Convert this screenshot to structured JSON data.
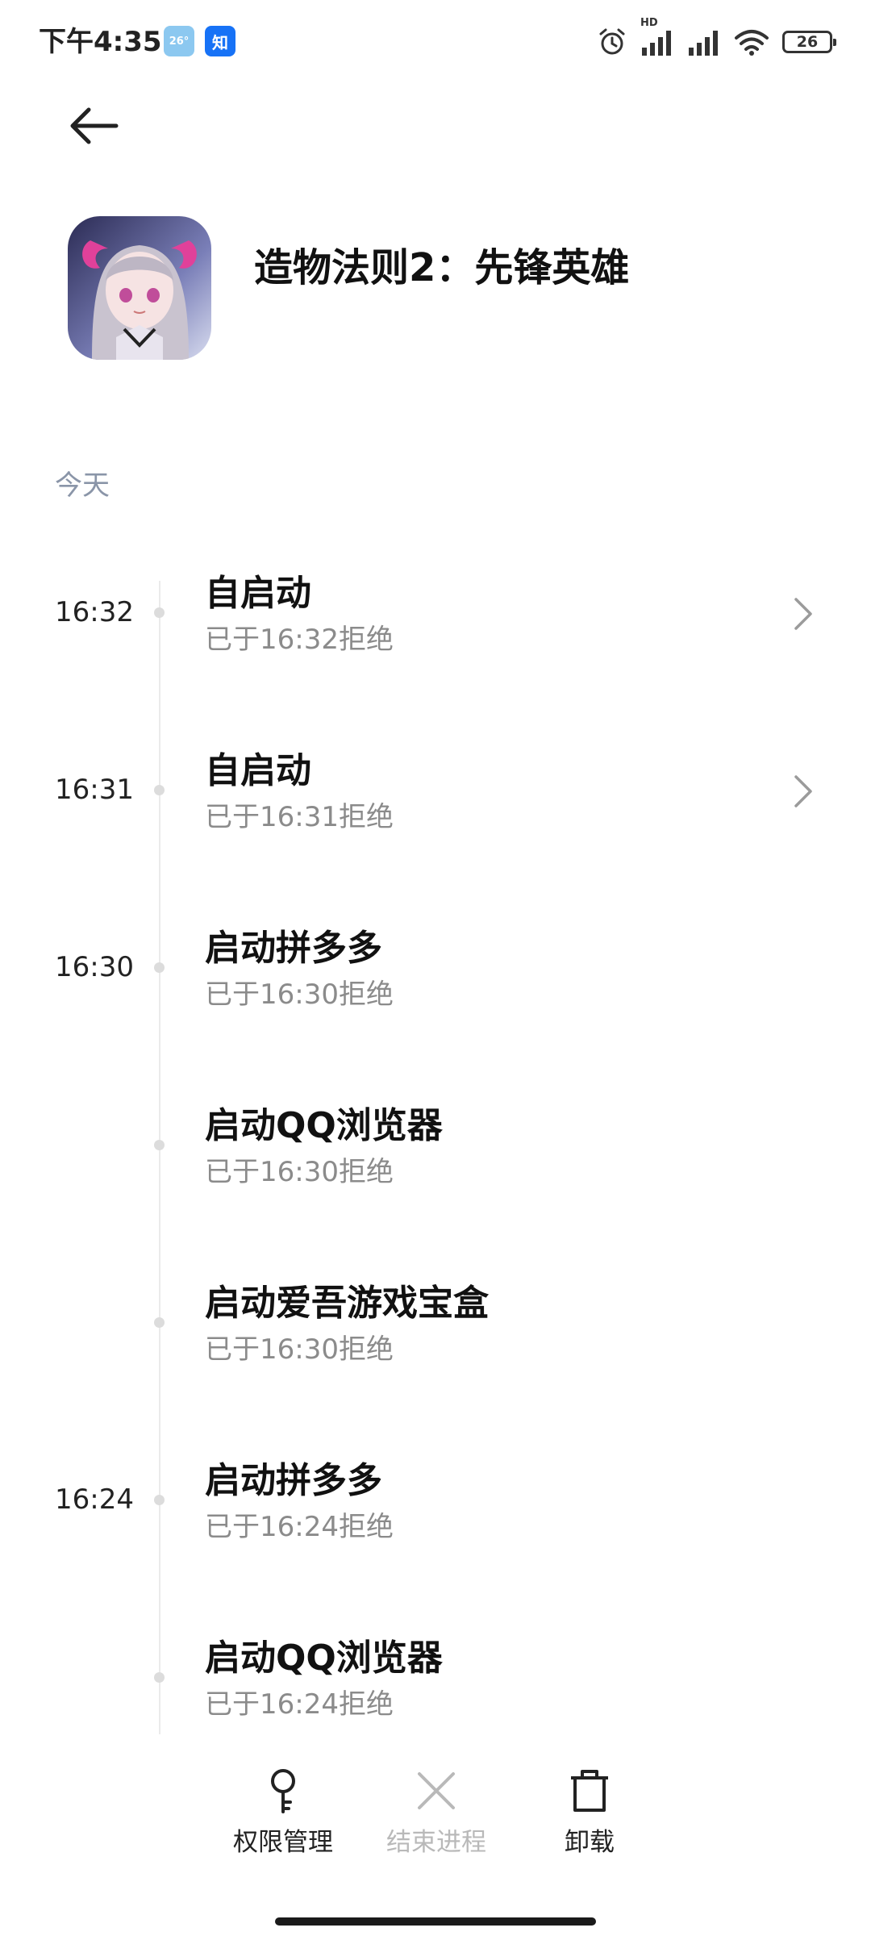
{
  "status_bar": {
    "time": "下午4:35",
    "weather_badge": "26°",
    "zhihu_badge": "知",
    "network_label": "HD",
    "battery_level": "26"
  },
  "header": {
    "app_name": "造物法则2：先锋英雄"
  },
  "timeline": {
    "section_label": "今天",
    "events": [
      {
        "time": "16:32",
        "title": "自启动",
        "subtitle": "已于16:32拒绝",
        "has_chevron": true
      },
      {
        "time": "16:31",
        "title": "自启动",
        "subtitle": "已于16:31拒绝",
        "has_chevron": true
      },
      {
        "time": "16:30",
        "title": "启动拼多多",
        "subtitle": "已于16:30拒绝",
        "has_chevron": false
      },
      {
        "time": "",
        "title": "启动QQ浏览器",
        "subtitle": "已于16:30拒绝",
        "has_chevron": false
      },
      {
        "time": "",
        "title": "启动爱吾游戏宝盒",
        "subtitle": "已于16:30拒绝",
        "has_chevron": false
      },
      {
        "time": "16:24",
        "title": "启动拼多多",
        "subtitle": "已于16:24拒绝",
        "has_chevron": false
      },
      {
        "time": "",
        "title": "启动QQ浏览器",
        "subtitle": "已于16:24拒绝",
        "has_chevron": false
      }
    ]
  },
  "bottom_bar": {
    "permissions_label": "权限管理",
    "end_process_label": "结束进程",
    "uninstall_label": "卸载"
  },
  "icons": {
    "back": "arrow-left-icon",
    "chevron": "chevron-right-icon",
    "permissions": "key-icon",
    "end_process": "close-icon",
    "uninstall": "trash-icon"
  },
  "colors": {
    "section_label": "#8a95a8",
    "subtitle": "#8b8b8b",
    "disabled": "#b9b9b9",
    "zhihu_blue": "#1772f6",
    "app_icon_pink": "#e0419a"
  }
}
